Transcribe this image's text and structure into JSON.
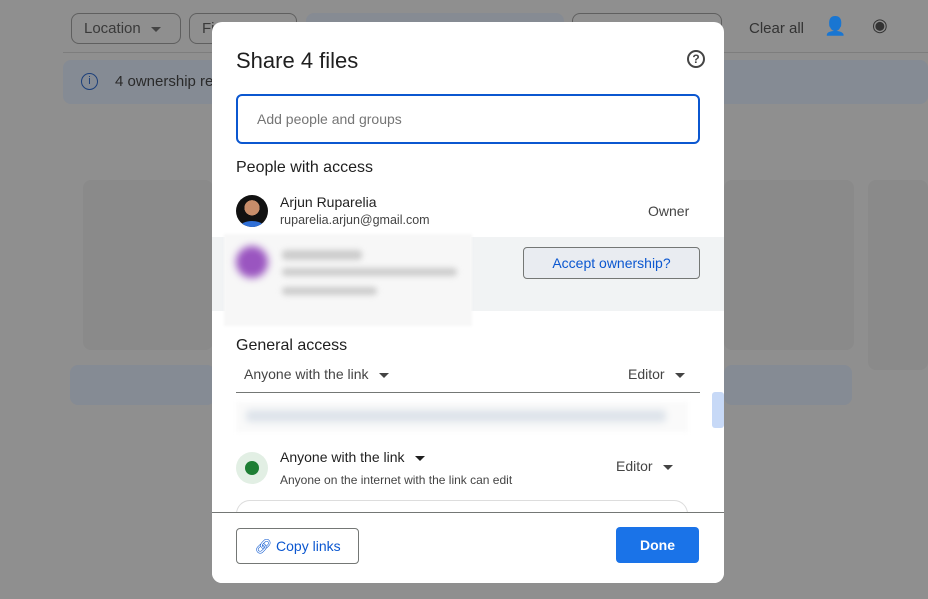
{
  "background": {
    "filters": [
      "Location",
      "Fi"
    ],
    "clear_all": "Clear all",
    "banner_text": "4 ownership re",
    "icons": [
      "add-person-icon",
      "eye-icon"
    ]
  },
  "dialog": {
    "title": "Share 4 files",
    "add_placeholder": "Add people and groups",
    "people_heading": "People with access",
    "owner": {
      "name": "Arjun Ruparelia",
      "email": "ruparelia.arjun@gmail.com",
      "role": "Owner"
    },
    "accept_label": "Accept ownership?",
    "general_heading": "General access",
    "general_dropdown": "Anyone with the link",
    "general_role": "Editor",
    "link_access": {
      "label": "Anyone with the link",
      "description": "Anyone on the internet with the link can edit",
      "role": "Editor"
    },
    "copy_links": "Copy links",
    "done": "Done"
  },
  "colors": {
    "primary": "#1a73e8",
    "link": "#0b57d0"
  }
}
